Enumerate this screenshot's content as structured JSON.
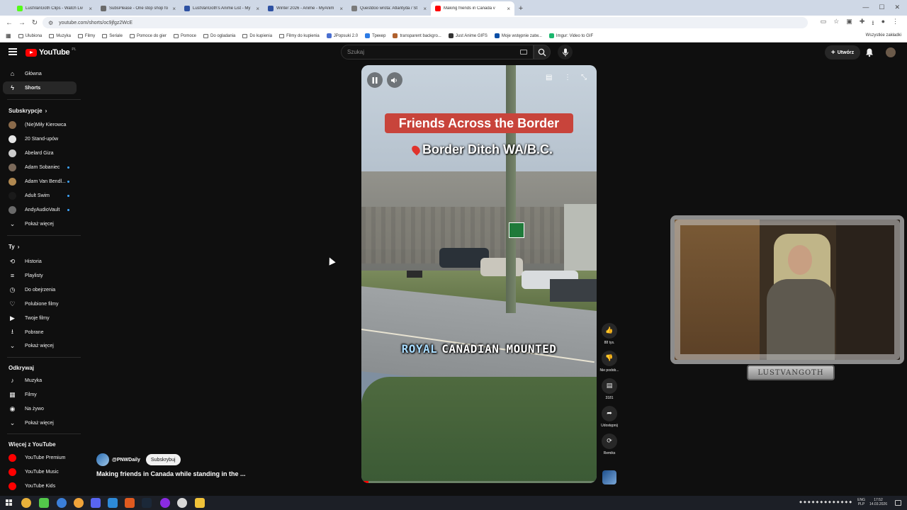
{
  "browser": {
    "tabs": [
      {
        "title": "LustVanGoth Clips - Watch Liv",
        "color": "#53fc18",
        "active": false
      },
      {
        "title": "SubsPlease - One stop shop fo",
        "color": "#6a6a6a",
        "active": false
      },
      {
        "title": "LustVanGoth's Anime List - My",
        "color": "#2e51a2",
        "active": false
      },
      {
        "title": "Winter 2026 - Anime - MyAnim",
        "color": "#2e51a2",
        "active": false
      },
      {
        "title": "Questdoo wrota: Atlantyda / St",
        "color": "#7a7a7a",
        "active": false
      },
      {
        "title": "Making friends in Canada v",
        "color": "#ff0000",
        "active": true
      }
    ],
    "url": "youtube.com/shorts/oc9jfgz2WcE",
    "bookmarks": [
      {
        "label": "Ulubiona",
        "type": "folder"
      },
      {
        "label": "Muzyka",
        "type": "folder"
      },
      {
        "label": "Filmy",
        "type": "folder"
      },
      {
        "label": "Seriale",
        "type": "folder"
      },
      {
        "label": "Pomoce do gier",
        "type": "folder"
      },
      {
        "label": "Pomoce",
        "type": "folder"
      },
      {
        "label": "Do ogladania",
        "type": "folder"
      },
      {
        "label": "Do kupienia",
        "type": "folder"
      },
      {
        "label": "Filmy do kupienia",
        "type": "folder"
      },
      {
        "label": "JPopsuki 2.0",
        "type": "site",
        "color": "#4a6fd0"
      },
      {
        "label": "Трекер",
        "type": "site",
        "color": "#2c7be5"
      },
      {
        "label": "transparent backgro...",
        "type": "site",
        "color": "#b0612e"
      },
      {
        "label": "Just Anime GIFS",
        "type": "site",
        "color": "#333"
      },
      {
        "label": "Moje wstępnie zatw...",
        "type": "site",
        "color": "#0a4ea6"
      },
      {
        "label": "Imgur: Video to GIF",
        "type": "site",
        "color": "#1bb76e"
      }
    ],
    "bookmarks_right": "Wszystkie zakładki"
  },
  "youtube": {
    "logo_text": "YouTube",
    "logo_country": "PL",
    "search_placeholder": "Szukaj",
    "create_label": "Utwórz",
    "sidebar": {
      "main": [
        {
          "label": "Główna",
          "icon": "home-icon",
          "selected": false
        },
        {
          "label": "Shorts",
          "icon": "shorts-icon",
          "selected": true
        }
      ],
      "subs_header": "Subskrypcje",
      "subs": [
        {
          "label": "(Nie)Miły Kierowca",
          "color": "#8a6a4a",
          "dot": false
        },
        {
          "label": "20 Stand-upów",
          "color": "#e6e6e6",
          "dot": false
        },
        {
          "label": "Abelard Giza",
          "color": "#cccccc",
          "dot": false
        },
        {
          "label": "Adam Sobaniec",
          "color": "#7c6a5a",
          "dot": true
        },
        {
          "label": "Adam Van Bendl...",
          "color": "#b08850",
          "dot": true
        },
        {
          "label": "Adult Swim",
          "color": "#1a1a1a",
          "dot": true
        },
        {
          "label": "AndyAudioVault",
          "color": "#6a6a6a",
          "dot": true
        }
      ],
      "subs_more": "Pokaż więcej",
      "you_header": "Ty",
      "you": [
        {
          "label": "Historia",
          "icon": "history-icon"
        },
        {
          "label": "Playlisty",
          "icon": "playlist-icon"
        },
        {
          "label": "Do obejrzenia",
          "icon": "watch-later-icon"
        },
        {
          "label": "Polubione filmy",
          "icon": "like-icon"
        },
        {
          "label": "Twoje filmy",
          "icon": "your-videos-icon"
        },
        {
          "label": "Pobrane",
          "icon": "download-icon"
        }
      ],
      "you_more": "Pokaż więcej",
      "explore_header": "Odkrywaj",
      "explore": [
        {
          "label": "Muzyka",
          "icon": "music-icon"
        },
        {
          "label": "Filmy",
          "icon": "movies-icon"
        },
        {
          "label": "Na żywo",
          "icon": "live-icon"
        }
      ],
      "explore_more": "Pokaż więcej",
      "more_header": "Więcej z YouTube",
      "more": [
        {
          "label": "YouTube Premium"
        },
        {
          "label": "YouTube Music"
        },
        {
          "label": "YouTube Kids"
        }
      ]
    },
    "short": {
      "overlay_title": "Friends Across the Border",
      "overlay_location": "Border Ditch WA/B.C.",
      "caption_highlight": "ROYAL",
      "caption_rest": "CANADIAN MOUNTED",
      "progress": 0.03,
      "channel": "@PNWDaily",
      "subscribe_label": "Subskrybuj",
      "video_title": "Making friends in Canada while standing in the ..."
    },
    "actions": [
      {
        "icon": "thumbs-up-icon",
        "label": "88 tys."
      },
      {
        "icon": "thumbs-down-icon",
        "label": "Nie podob..."
      },
      {
        "icon": "comment-icon",
        "label": "3181"
      },
      {
        "icon": "share-icon",
        "label": "Udostępnij"
      },
      {
        "icon": "remix-icon",
        "label": "Remiks"
      }
    ]
  },
  "webcam": {
    "label": "LUSTVANGOTH"
  },
  "taskbar": {
    "lang_top": "ENG",
    "lang_bottom": "PLP",
    "time": "17:52",
    "date": "14.03.2026"
  }
}
